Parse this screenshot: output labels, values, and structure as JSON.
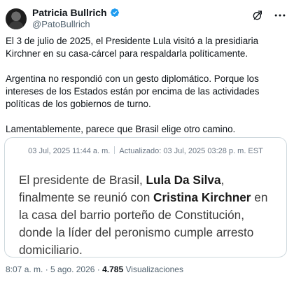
{
  "author": {
    "name": "Patricia Bullrich",
    "handle": "@PatoBullrich"
  },
  "icons": {
    "verified": "verified-badge-icon",
    "grok": "grok-icon",
    "more": "more-options-icon"
  },
  "colors": {
    "verified": "#1d9bf0",
    "text": "#0f1419",
    "secondary": "#536471"
  },
  "tweet": {
    "paragraph1": "El 3 de julio de 2025, el Presidente Lula visitó a la presidiaria Kirchner en su casa-cárcel para respaldarla políticamente.",
    "paragraph2": "Argentina no respondió con un gesto diplomático. Porque los intereses de los Estados están por encima de las actividades políticas de los gobiernos de turno.",
    "paragraph3": "Lamentablemente, parece que Brasil elige otro camino."
  },
  "quote": {
    "published": "03 Jul, 2025 11:44 a. m.",
    "updated": "Actualizado: 03 Jul, 2025 03:28 p. m. EST",
    "t1": "El presidente de Brasil, ",
    "b1": "Lula Da Silva",
    "t2": ", finalmente se reunió con ",
    "b2": "Cristina Kirchner",
    "t3": " en la casa del barrio porteño de Constitución, donde la líder del peronismo cumple arresto domiciliario."
  },
  "footer": {
    "time": "8:07 a. m.",
    "dot": " · ",
    "date": "5 ago. 2026",
    "views_count": "4.785",
    "views_label": " Visualizaciones"
  }
}
